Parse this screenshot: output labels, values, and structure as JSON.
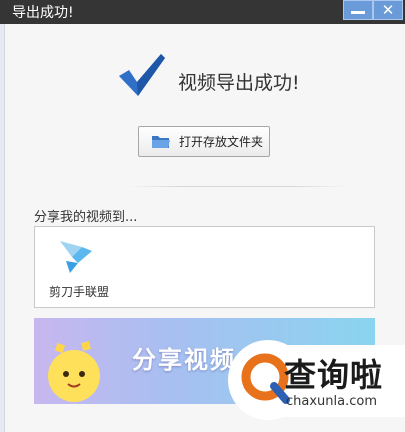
{
  "window": {
    "title": "导出成功!",
    "minimize_label": "minimize",
    "close_label": "close"
  },
  "result": {
    "icon": "checkmark-icon",
    "message": "视频导出成功!"
  },
  "open_folder": {
    "icon": "folder-icon",
    "label": "打开存放文件夹"
  },
  "share": {
    "heading": "分享我的视频到...",
    "targets": [
      {
        "label": "剪刀手联盟",
        "icon": "jiandao-app-icon"
      }
    ]
  },
  "banner": {
    "text": "分享视频"
  },
  "watermark": {
    "title": "查询啦",
    "domain": "chaxunla.com",
    "icon": "q-logo-icon"
  },
  "colors": {
    "titlebar": "#353535",
    "window_button": "#6a9bd8",
    "check": "#2f6fc7",
    "watermark_accent": "#e8721b"
  }
}
